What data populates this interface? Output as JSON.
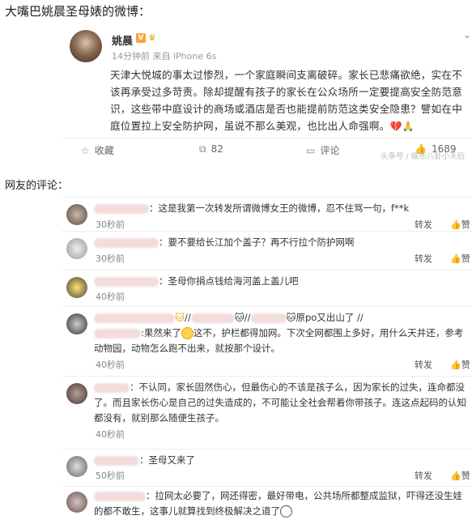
{
  "page_title": "大嘴巴姚晨圣母婊的微博：",
  "post": {
    "username": "姚晨",
    "badge": "V",
    "meta": "14分钟前 来自 iPhone 6s",
    "text": "天津大悦城的事太过惨烈，一个家庭瞬间支离破碎。家长已悲痛欲绝，实在不该再承受过多苛责。除却提醒有孩子的家长在公众场所一定要提高安全防范意识，这些带中庭设计的商场或酒店是否也能提前防范这类安全隐患？譬如在中庭位置拉上安全防护网，虽说不那么美观，也比出人命强啊。",
    "text_emoji": "💔🙏",
    "actions": {
      "favorite": "收藏",
      "repost_count": "82",
      "comment": "评论",
      "like_count": "1689"
    },
    "watermark": "头条号 / 娱乐八卦小天后"
  },
  "section_label": "网友的评论：",
  "comments": [
    {
      "text": "：这是我第一次转发所谓微博女王的微博，忍不住骂一句，f**k",
      "time": "30秒前",
      "repost": "转发",
      "like": "赞"
    },
    {
      "text": "：要不要给长江加个盖子？再不行拉个防护网啊",
      "time": "30秒前",
      "repost": "转发",
      "like": "赞"
    },
    {
      "text": "：圣母你捐点钱给海河盖上盖儿吧",
      "time": "40秒前",
      "repost": "",
      "like": ""
    },
    {
      "line1a": "//",
      "line1b": "//",
      "line1c": "原po又出山了 //",
      "text": ":果然来了",
      "text2": "这不，护栏都得加网。下次全网都围上多好，用什么天井还，参考动物园，动物怎么跑不出来，就按那个设计。",
      "time": "40秒前",
      "repost": "转发",
      "like": "赞"
    },
    {
      "text": "：不认同，家长固然伤心，但最伤心的不该是孩子么，因为家长的过失，连命都没了。而且家长伤心是自己的过失造成的，不可能让全社会帮着你带孩子。连这点起码的认知都没有，就别那么随便生孩子。",
      "time": "40秒前",
      "repost": "",
      "like": ""
    },
    {
      "text": "：圣母又来了",
      "time": "50秒前",
      "repost": "转发",
      "like": "赞"
    },
    {
      "text": "：拉网太必要了，网还得密，最好带电，公共场所都整成监狱，吓得还没生娃的都不敢生，这事儿就算找到终极解决之道了",
      "time": "",
      "repost": "",
      "like": ""
    }
  ],
  "colors": {
    "accent": "#f7a33a",
    "heart": "#d9203b",
    "muted": "#999999"
  }
}
